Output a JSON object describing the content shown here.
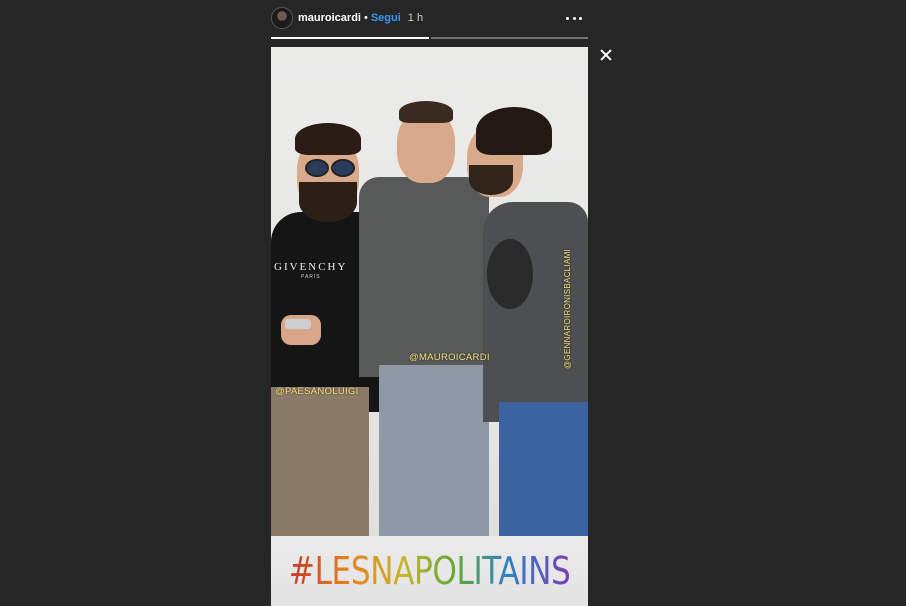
{
  "header": {
    "username": "mauroicardi",
    "separator": "•",
    "follow_label": "Segui",
    "time": "1 h"
  },
  "story": {
    "progress_segments": [
      {
        "state": "current",
        "progress": 1.0
      },
      {
        "state": "upcoming",
        "progress": 0.0
      }
    ],
    "tags": {
      "left": "@PAESANOLUIGI",
      "center": "@MAUROICARDI",
      "right": "@GENNAROIRONISBACLIAMI"
    },
    "shirt_brand": "GIVENCHY",
    "shirt_sub": "PARIS",
    "hashtag": "#LESNAPOLITAINS"
  },
  "colors": {
    "background": "#262626",
    "follow_link": "#3897f0",
    "tag_text": "#f3dd7a"
  },
  "icons": {
    "more": "more-horizontal-icon",
    "close": "close-icon"
  }
}
